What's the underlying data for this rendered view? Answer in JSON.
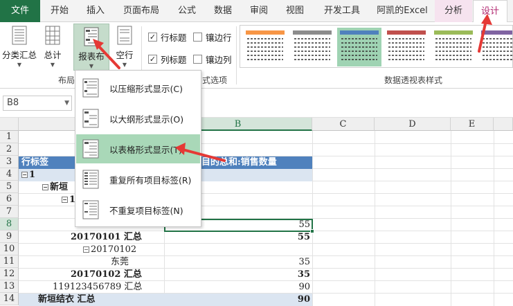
{
  "tabs": [
    "文件",
    "开始",
    "插入",
    "页面布局",
    "公式",
    "数据",
    "审阅",
    "视图",
    "开发工具",
    "阿凯的Excel",
    "分析",
    "设计"
  ],
  "ribbon": {
    "subtotal": "分类汇总",
    "grand_total": "总计",
    "report_layout": "报表布",
    "blank_rows": "空行",
    "layout_group": "布局",
    "row_headers": "行标题",
    "banded_rows": "镶边行",
    "col_headers": "列标题",
    "banded_cols": "镶边列",
    "style_options_group": "式选项",
    "styles_group": "数据透视表样式"
  },
  "namebox": "B8",
  "menu": {
    "items": [
      "以压缩形式显示(C)",
      "以大纲形式显示(O)",
      "以表格形式显示(T)",
      "重复所有项目标签(R)",
      "不重复项目标签(N)"
    ]
  },
  "grid": {
    "columns": [
      "B",
      "C",
      "D",
      "E"
    ],
    "rows": [
      "1",
      "2",
      "3",
      "4",
      "5",
      "6",
      "7",
      "8",
      "9",
      "10",
      "11",
      "12",
      "13",
      "14"
    ],
    "header_left": "行标签",
    "header_right": "目的总和:销售数量",
    "r4": "1",
    "r5": "新垣",
    "r6": "1",
    "r8_val": "55",
    "r9_label": "20170101 汇总",
    "r9_val": "55",
    "r10": "20170102",
    "r11_label": "东莞",
    "r11_val": "35",
    "r12_label": "20170102 汇总",
    "r12_val": "35",
    "r13_label": "119123456789 汇总",
    "r13_val": "90",
    "r14_label": "新垣结衣 汇总",
    "r14_val": "90"
  },
  "colors": {
    "file_tab": "#217346",
    "design_tab": "#b0246e",
    "pivot_header": "#4f81bd",
    "menu_highlight": "#a9d8b8",
    "arrow": "#e53935"
  }
}
